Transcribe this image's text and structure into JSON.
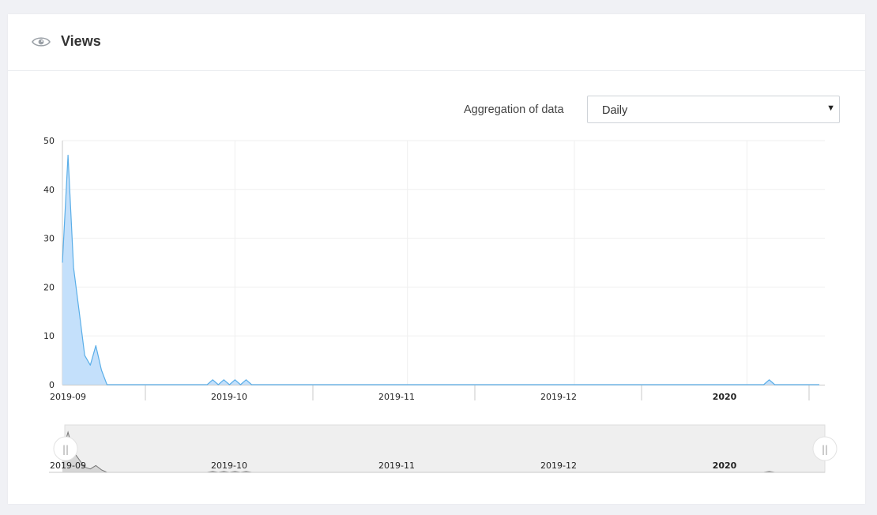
{
  "header": {
    "title": "Views",
    "icon": "eye-icon"
  },
  "controls": {
    "aggregation_label": "Aggregation of data",
    "aggregation_value": "Daily",
    "aggregation_options": [
      "Daily"
    ]
  },
  "chart_data": {
    "type": "area",
    "title": "",
    "xlabel": "",
    "ylabel": "",
    "ylim": [
      0,
      50
    ],
    "yticks": [
      0,
      10,
      20,
      30,
      40,
      50
    ],
    "xlim": [
      "2019-08-31",
      "2020-01-15"
    ],
    "xticks": [
      {
        "date": "2019-09-01",
        "label": "2019-09",
        "bold": false
      },
      {
        "date": "2019-10-01",
        "label": "2019-10",
        "bold": false
      },
      {
        "date": "2019-11-01",
        "label": "2019-11",
        "bold": false
      },
      {
        "date": "2019-12-01",
        "label": "2019-12",
        "bold": false
      },
      {
        "date": "2020-01-01",
        "label": "2020",
        "bold": true
      }
    ],
    "grid": true,
    "colors": {
      "line": "#5aaee8",
      "fill": "#c4e0fb",
      "navigator_line": "#777777",
      "navigator_fill": "#d6d6d6"
    },
    "series": [
      {
        "points": [
          [
            "2019-09-01",
            25
          ],
          [
            "2019-09-02",
            47
          ],
          [
            "2019-09-03",
            24
          ],
          [
            "2019-09-04",
            15
          ],
          [
            "2019-09-05",
            6
          ],
          [
            "2019-09-06",
            4
          ],
          [
            "2019-09-07",
            8
          ],
          [
            "2019-09-08",
            3
          ],
          [
            "2019-09-09",
            0
          ],
          [
            "2019-09-27",
            0
          ],
          [
            "2019-09-28",
            1
          ],
          [
            "2019-09-29",
            0
          ],
          [
            "2019-09-30",
            1
          ],
          [
            "2019-10-01",
            0
          ],
          [
            "2019-10-02",
            1
          ],
          [
            "2019-10-03",
            0
          ],
          [
            "2019-10-04",
            1
          ],
          [
            "2019-10-05",
            0
          ],
          [
            "2020-01-05",
            0
          ],
          [
            "2020-01-06",
            1
          ],
          [
            "2020-01-07",
            0
          ],
          [
            "2020-01-15",
            0
          ]
        ]
      }
    ],
    "navigator": {
      "labels": [
        "2019-09",
        "2019-10",
        "2019-11",
        "2019-12",
        "2020"
      ],
      "left_handle": "||",
      "right_handle": "||"
    }
  }
}
